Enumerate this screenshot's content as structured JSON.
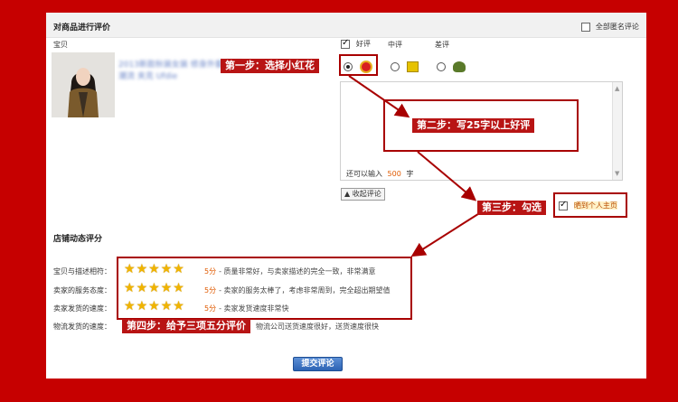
{
  "header": {
    "title": "对商品进行评价",
    "anonymous_label": "全部匿名评论",
    "anonymous_checked": false
  },
  "item": {
    "column_label": "宝贝",
    "image_icon": "product-photo-woman-jacket",
    "blurred_title": "2013新款秋装女装 修身外套 韩版潮流 夹克 Ufdie"
  },
  "rating": {
    "good_label": "好评",
    "mid_label": "中评",
    "bad_label": "差评",
    "selected": "good",
    "good_icon": "red-flower-icon",
    "mid_icon": "neutral-icon",
    "bad_icon": "negative-icon"
  },
  "comment": {
    "remain_prefix": "还可以输入",
    "remain_count": "500",
    "remain_suffix": "字",
    "collapse_label": "▲ 收起评论"
  },
  "share": {
    "label": "晒到个人主页",
    "checked": true
  },
  "shop_rating": {
    "section_title": "店铺动态评分",
    "rows": [
      {
        "label": "宝贝与描述相符：",
        "stars": 5,
        "score": "5分",
        "text": "- 质量非常好，与卖家描述的完全一致，非常满意"
      },
      {
        "label": "卖家的服务态度：",
        "stars": 5,
        "score": "5分",
        "text": "- 卖家的服务太棒了，考虑非常周到，完全超出期望值"
      },
      {
        "label": "卖家发货的速度：",
        "stars": 5,
        "score": "5分",
        "text": "- 卖家发货速度非常快"
      },
      {
        "label": "物流发货的速度：",
        "stars": 5,
        "score": "",
        "text": "物流公司送货速度很好，送货速度很快"
      }
    ]
  },
  "callouts": {
    "step1": "第一步：选择小红花",
    "step2": "第二步：写25字以上好评",
    "step3": "第三步：勾选",
    "step4": "第四步：给予三项五分评价"
  },
  "submit_label": "提交评论",
  "colors": {
    "background": "#c60000",
    "callout": "#b81414",
    "star": "#f0b400",
    "score": "#e05a00",
    "submit": "#2c63b4"
  }
}
